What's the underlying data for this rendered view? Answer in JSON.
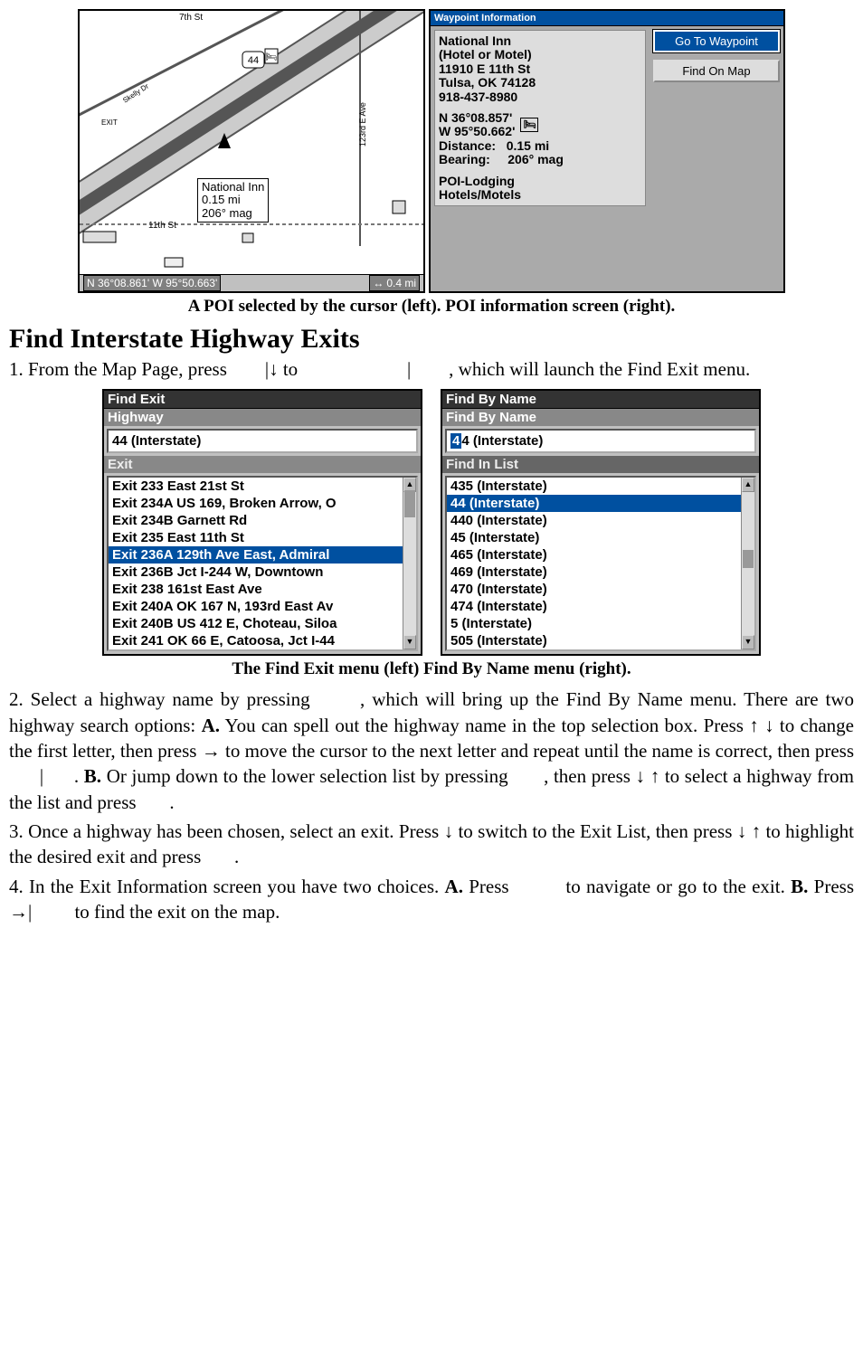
{
  "map": {
    "popup": {
      "name": "National Inn",
      "distance": "0.15 mi",
      "bearing": "206° mag"
    },
    "road_label_7th": "7th St",
    "road_label_11th": "11th St",
    "road_label_vert": "123rd E Ave",
    "hwy_shield": "44",
    "status_left": "N    36°08.861'     W     95°50.663'",
    "status_right": "0.4 mi",
    "arrow_icon": "↔"
  },
  "waypoint_info": {
    "title": "Waypoint Information",
    "name": "National Inn",
    "subtype": "(Hotel or Motel)",
    "address1": "11910 E 11th St",
    "address2": "Tulsa, OK 74128",
    "phone": "918-437-8980",
    "lat": "N    36°08.857'",
    "lon": "W    95°50.662'",
    "distance_label": "Distance:",
    "distance": "0.15 mi",
    "bearing_label": "Bearing:",
    "bearing": "206° mag",
    "category": "POI-Lodging",
    "subcategory": "Hotels/Motels",
    "btn_goto": "Go To Waypoint",
    "btn_find": "Find On Map"
  },
  "caption1": "A POI selected by the cursor (left). POI information screen (right).",
  "heading": "Find Interstate Highway Exits",
  "step1_a": "1. From the Map Page, press ",
  "step1_b": "|↓ to ",
  "step1_c": "|",
  "step1_d": ", which will launch the Find Exit menu.",
  "find_exit": {
    "title": "Find Exit",
    "section1": "Highway",
    "input": "44 (Interstate)",
    "section2": "Exit",
    "items": [
      "Exit 233 East 21st St",
      "Exit 234A US 169, Broken Arrow, O",
      "Exit 234B Garnett Rd",
      "Exit 235 East 11th St",
      "Exit 236A 129th Ave East, Admiral",
      "Exit 236B Jct I-244 W, Downtown",
      "Exit 238 161st East Ave",
      "Exit 240A OK 167 N, 193rd East Av",
      "Exit 240B US 412 E, Choteau, Siloa",
      "Exit 241 OK 66 E, Catoosa, Jct I-44"
    ],
    "selected_index": 4
  },
  "find_name": {
    "title": "Find By Name",
    "section1": "Find By Name",
    "cursor_char": "4",
    "input_rest": "4 (Interstate)",
    "section2": "Find In List",
    "items": [
      "435 (Interstate)",
      "44 (Interstate)",
      "440 (Interstate)",
      "45 (Interstate)",
      "465 (Interstate)",
      "469 (Interstate)",
      "470 (Interstate)",
      "474 (Interstate)",
      "5 (Interstate)",
      "505 (Interstate)"
    ],
    "selected_index": 1
  },
  "caption2": "The Find Exit menu (left) Find By Name menu (right).",
  "step2_a": "2. Select a highway name by pressing ",
  "step2_b": ", which will bring up the Find By Name menu. There are two highway search options: ",
  "step2_bold_a": "A.",
  "step2_c": " You can spell out the highway name in the top selection box. Press ↑ ↓ to change the first letter, then press → to move the cursor to the next letter and repeat until the name is correct, then press ",
  "step2_d": "|",
  "step2_e": ". ",
  "step2_bold_b": "B.",
  "step2_f": " Or jump down to the lower selection list by pressing ",
  "step2_g": ", then press ↓ ↑ to select a highway from the list and press ",
  "step2_h": ".",
  "step3_a": "3. Once a highway has been chosen, select an exit. Press ↓ to switch to the Exit List, then press ↓ ↑ to highlight the desired exit and press ",
  "step3_b": ".",
  "step4_a": "4. In the Exit Information screen you have two choices. ",
  "step4_bold_a": "A.",
  "step4_b": " Press ",
  "step4_c": " to navigate or go to the exit. ",
  "step4_bold_b": "B.",
  "step4_d": " Press →|",
  "step4_e": " to find the exit on the map."
}
